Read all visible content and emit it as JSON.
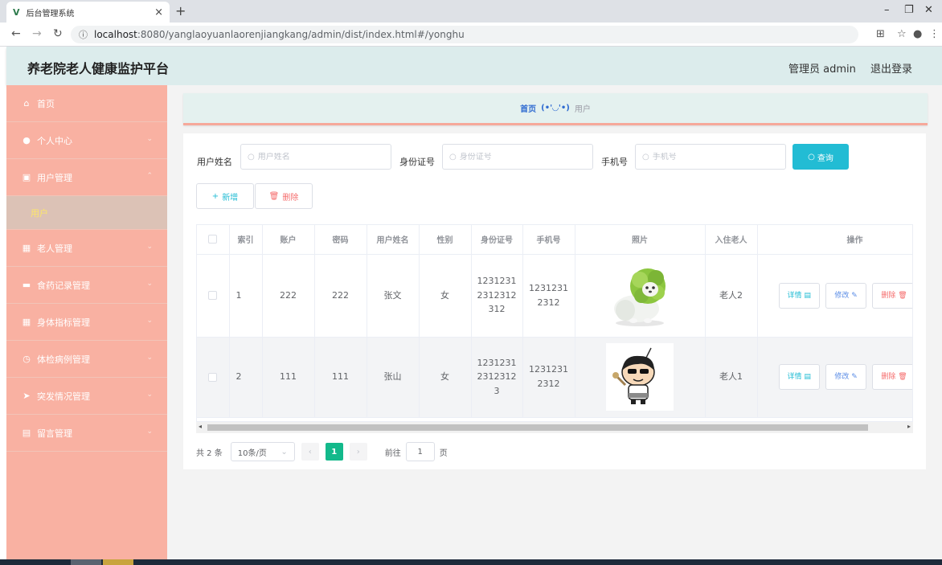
{
  "browser": {
    "tab_title": "后台管理系统",
    "tab_logo": "V",
    "url_host": "localhost",
    "url_rest": ":8080/yanglaoyuanlaorenjiangkang/admin/dist/index.html#/yonghu"
  },
  "header": {
    "title": "养老院老人健康监护平台",
    "user": "管理员 admin",
    "logout": "退出登录"
  },
  "sidebar": {
    "items": [
      {
        "icon": "home-icon",
        "label": "首页",
        "arrow": ""
      },
      {
        "icon": "user-icon",
        "label": "个人中心",
        "arrow": "down"
      },
      {
        "icon": "clipboard-icon",
        "label": "用户管理",
        "arrow": "up"
      },
      {
        "icon": "grid-icon",
        "label": "老人管理",
        "arrow": "down"
      },
      {
        "icon": "briefcase-icon",
        "label": "食药记录管理",
        "arrow": "down"
      },
      {
        "icon": "table-icon",
        "label": "身体指标管理",
        "arrow": "down"
      },
      {
        "icon": "clock-icon",
        "label": "体检病例管理",
        "arrow": "down"
      },
      {
        "icon": "send-icon",
        "label": "突发情况管理",
        "arrow": "down"
      },
      {
        "icon": "notebook-icon",
        "label": "留言管理",
        "arrow": "down"
      }
    ],
    "submenu_active": "用户"
  },
  "breadcrumb": {
    "home": "首页",
    "face": "(•'◡'•)",
    "current": "用户"
  },
  "search": {
    "name_label": "用户姓名",
    "name_placeholder": "用户姓名",
    "id_label": "身份证号",
    "id_placeholder": "身份证号",
    "phone_label": "手机号",
    "phone_placeholder": "手机号",
    "query_label": "查询"
  },
  "actions": {
    "add_label": "新增",
    "delete_label": "删除"
  },
  "table": {
    "headers": [
      "",
      "索引",
      "账户",
      "密码",
      "用户姓名",
      "性别",
      "身份证号",
      "手机号",
      "照片",
      "入住老人",
      "操作"
    ],
    "rows": [
      {
        "index": "1",
        "account": "222",
        "password": "222",
        "name": "张文",
        "gender": "女",
        "idcard_lines": [
          "1231231",
          "2312312",
          "312"
        ],
        "phone_lines": [
          "1231231",
          "2312"
        ],
        "photo": "cabbage-dog-photo",
        "elder": "老人2"
      },
      {
        "index": "2",
        "account": "111",
        "password": "111",
        "name": "张山",
        "gender": "女",
        "idcard_lines": [
          "1231231",
          "2312312",
          "3"
        ],
        "phone_lines": [
          "1231231",
          "2312"
        ],
        "photo": "cartoon-boy-photo",
        "elder": "老人1"
      }
    ],
    "op_detail": "详情",
    "op_edit": "修改",
    "op_delete": "删除"
  },
  "pagination": {
    "total": "共 2 条",
    "page_size": "10条/页",
    "current_page": "1",
    "goto_prefix": "前往",
    "goto_value": "1",
    "goto_suffix": "页"
  },
  "colors": {
    "sidebar_bg": "#f9b1a2",
    "header_bg": "#dcecec",
    "accent": "#22bcd4",
    "active_page": "#13b98b",
    "danger": "#f56c6c"
  }
}
